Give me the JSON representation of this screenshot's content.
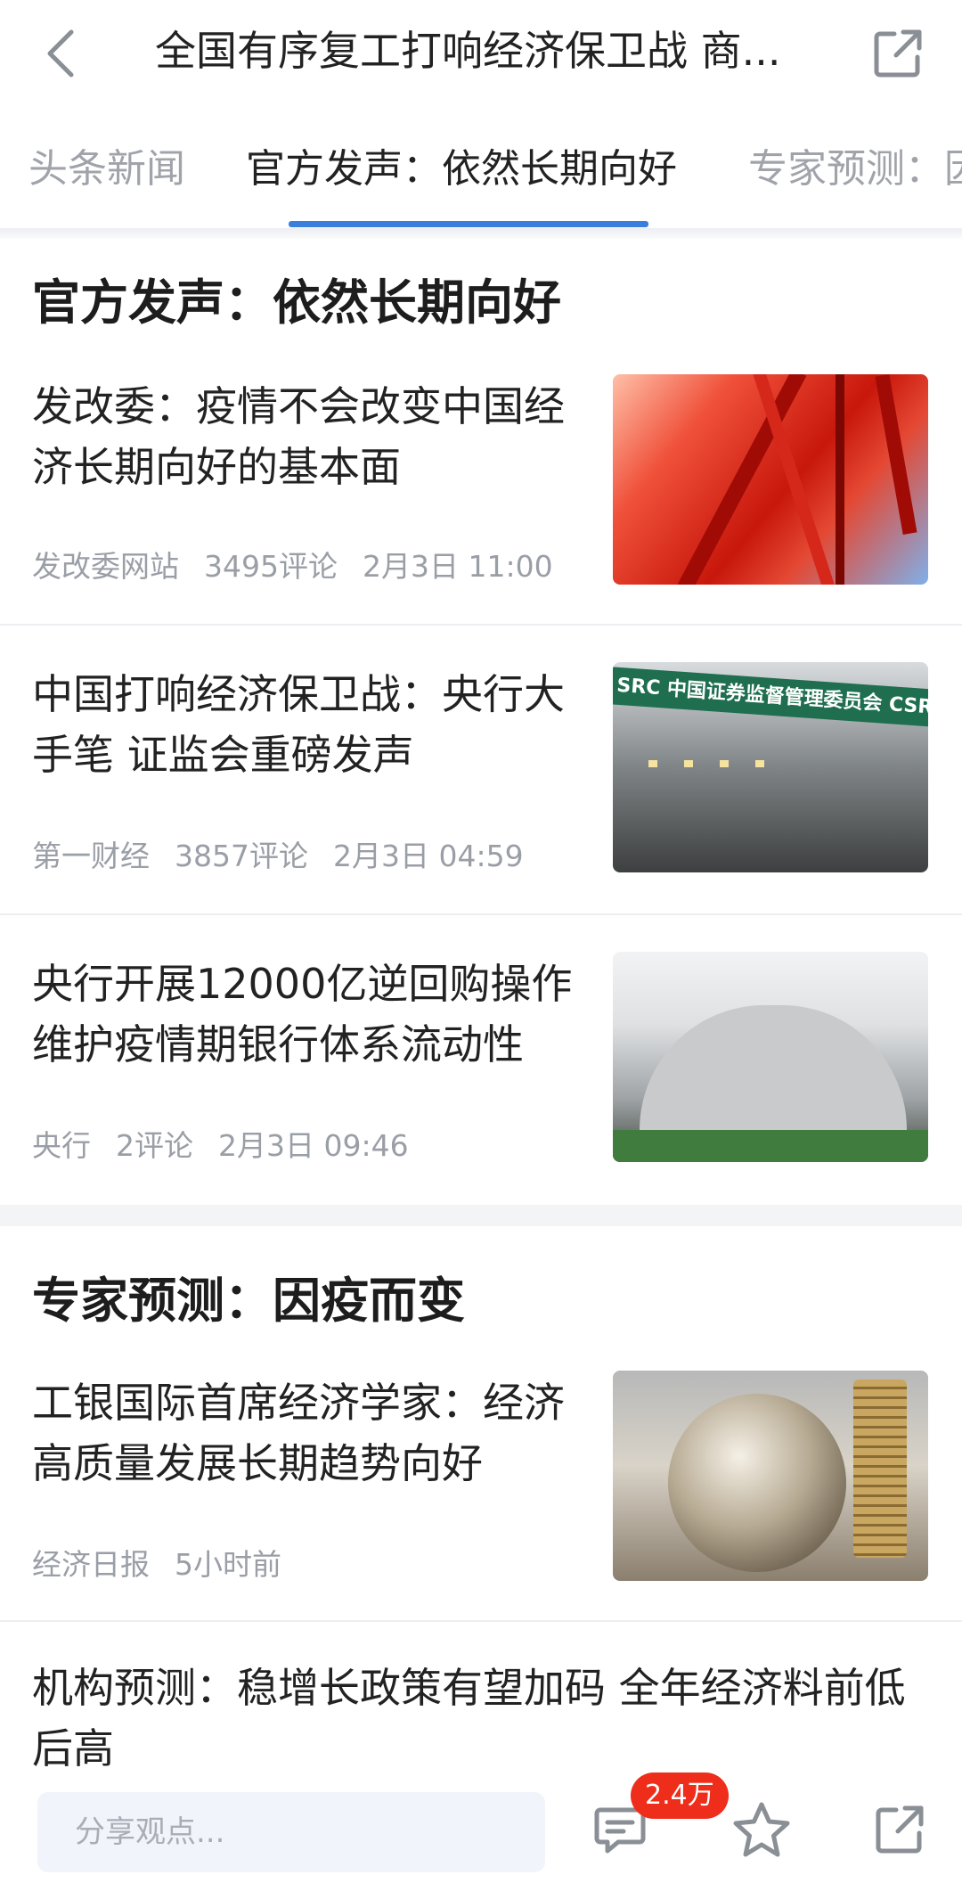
{
  "header": {
    "title": "全国有序复工打响经济保卫战 商...",
    "back_icon": "chevron-left-icon",
    "share_icon": "share-external-icon"
  },
  "tabs": [
    {
      "label": "头条新闻",
      "active": false
    },
    {
      "label": "官方发声：依然长期向好",
      "active": true
    },
    {
      "label": "专家预测：因",
      "active": false
    }
  ],
  "sections": [
    {
      "heading": "官方发声：依然长期向好",
      "articles": [
        {
          "title": "发改委：疫情不会改变中国经济长期向好的基本面",
          "source": "发改委网站",
          "comments": "3495评论",
          "time": "2月3日 11:00",
          "thumb": "red-steel-structure"
        },
        {
          "title": "中国打响经济保卫战：央行大手笔 证监会重磅发声",
          "source": "第一财经",
          "comments": "3857评论",
          "time": "2月3日 04:59",
          "thumb": "csrc-building",
          "thumb_banner": "SRC 中国证券监督管理委员会 CSRC"
        },
        {
          "title": "央行开展12000亿逆回购操作维护疫情期银行体系流动性",
          "source": "央行",
          "comments": "2评论",
          "time": "2月3日 09:46",
          "thumb": "pboc-building"
        }
      ]
    },
    {
      "heading": "专家预测：因疫而变",
      "articles": [
        {
          "title": "工银国际首席经济学家：经济高质量发展长期趋势向好",
          "source": "经济日报",
          "time": "5小时前",
          "thumb": "globe-coins"
        },
        {
          "title": "机构预测：稳增长政策有望加码 全年经济料前低后高"
        }
      ]
    }
  ],
  "bottom_bar": {
    "input_placeholder": "分享观点...",
    "comment_count": "2.4万",
    "comment_icon": "comment-icon",
    "star_icon": "star-icon",
    "share_icon": "share-external-icon"
  },
  "colors": {
    "accent": "#3b7fdc",
    "badge": "#ee2d1a",
    "meta_text": "#9a9ea6",
    "inactive_tab": "#a0a4aa"
  }
}
